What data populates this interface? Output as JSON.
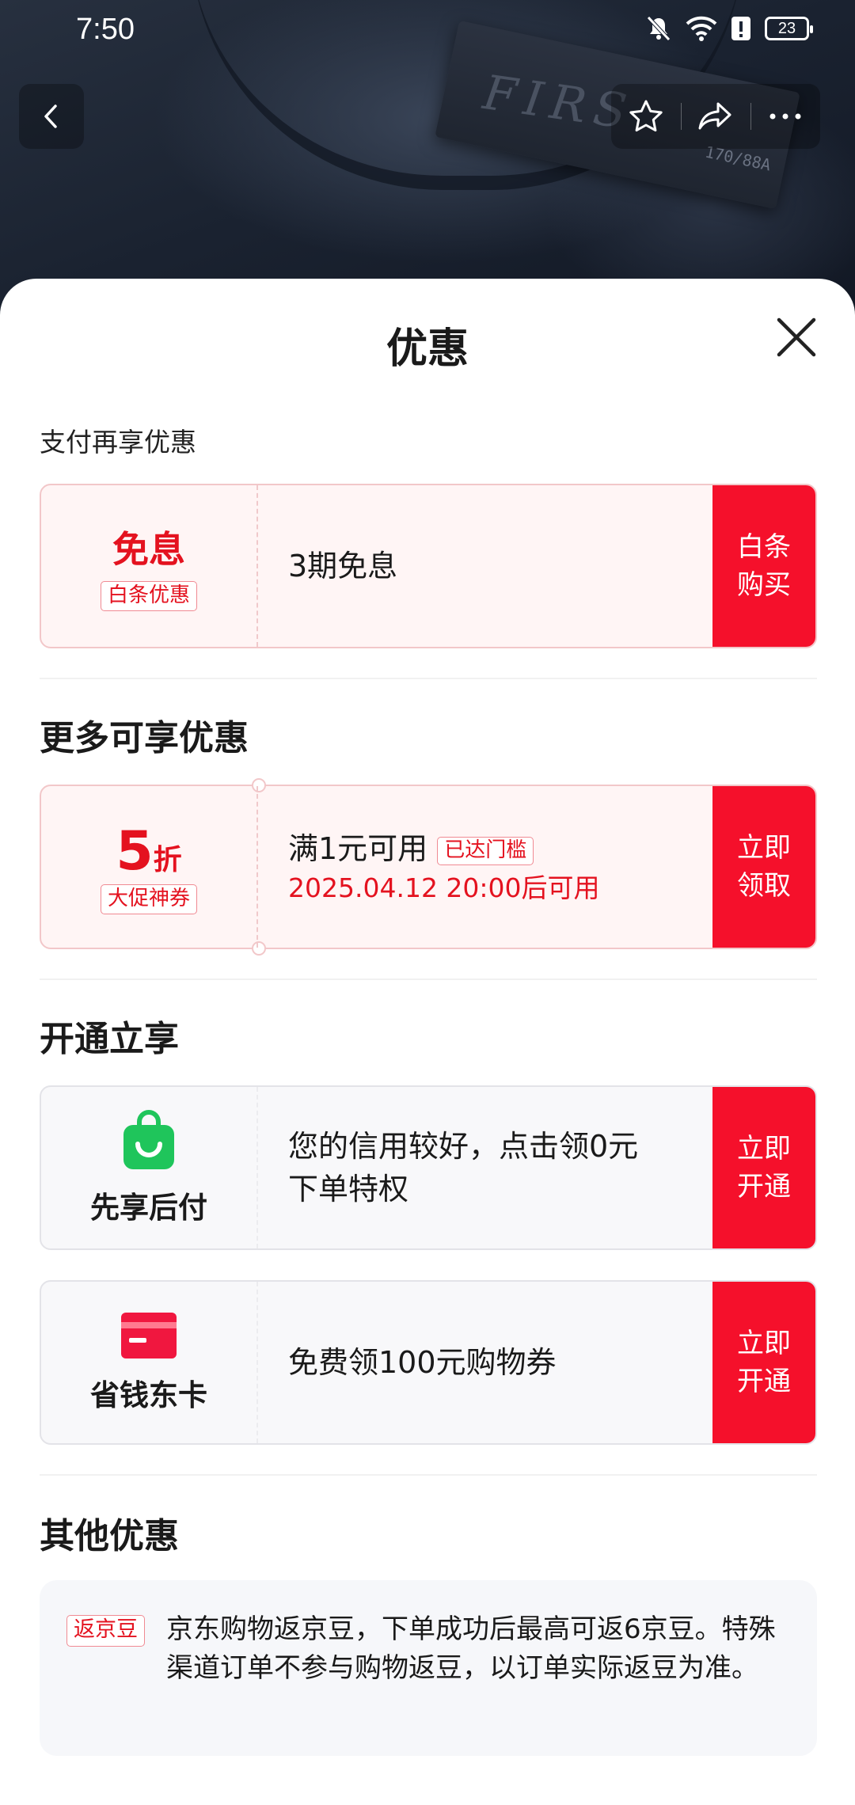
{
  "status_bar": {
    "time": "7:50",
    "battery": "23"
  },
  "product_image": {
    "brand_text": "FIRS",
    "size_text": "170/88A"
  },
  "sheet": {
    "title": "优惠"
  },
  "pay_section": {
    "label": "支付再享优惠",
    "card": {
      "headline": "免息",
      "badge": "白条优惠",
      "description": "3期免息",
      "cta_line1": "白条",
      "cta_line2": "购买"
    }
  },
  "more_section": {
    "label": "更多可享优惠",
    "card": {
      "discount_number": "5",
      "discount_unit": "折",
      "badge": "大促神券",
      "condition": "满1元可用",
      "threshold_badge": "已达门槛",
      "available_time": "2025.04.12 20:00后可用",
      "cta_line1": "立即",
      "cta_line2": "领取"
    }
  },
  "open_section": {
    "label": "开通立享",
    "cards": [
      {
        "name": "先享后付",
        "icon": "shopping-bag-icon",
        "icon_color": "#1fc55b",
        "description_line1": "您的信用较好，点击领0元",
        "description_line2": "下单特权",
        "cta_line1": "立即",
        "cta_line2": "开通"
      },
      {
        "name": "省钱东卡",
        "icon": "card-icon",
        "icon_color": "#f0173f",
        "description_line1": "免费领100元购物券",
        "cta_line1": "立即",
        "cta_line2": "开通"
      }
    ]
  },
  "other_section": {
    "label": "其他优惠",
    "tag": "返京豆",
    "text": "京东购物返京豆，下单成功后最高可返6京豆。特殊渠道订单不参与购物返豆，以订单实际返豆为准。"
  },
  "colors": {
    "accent": "#f5102b",
    "accent_text": "#e4121f"
  }
}
